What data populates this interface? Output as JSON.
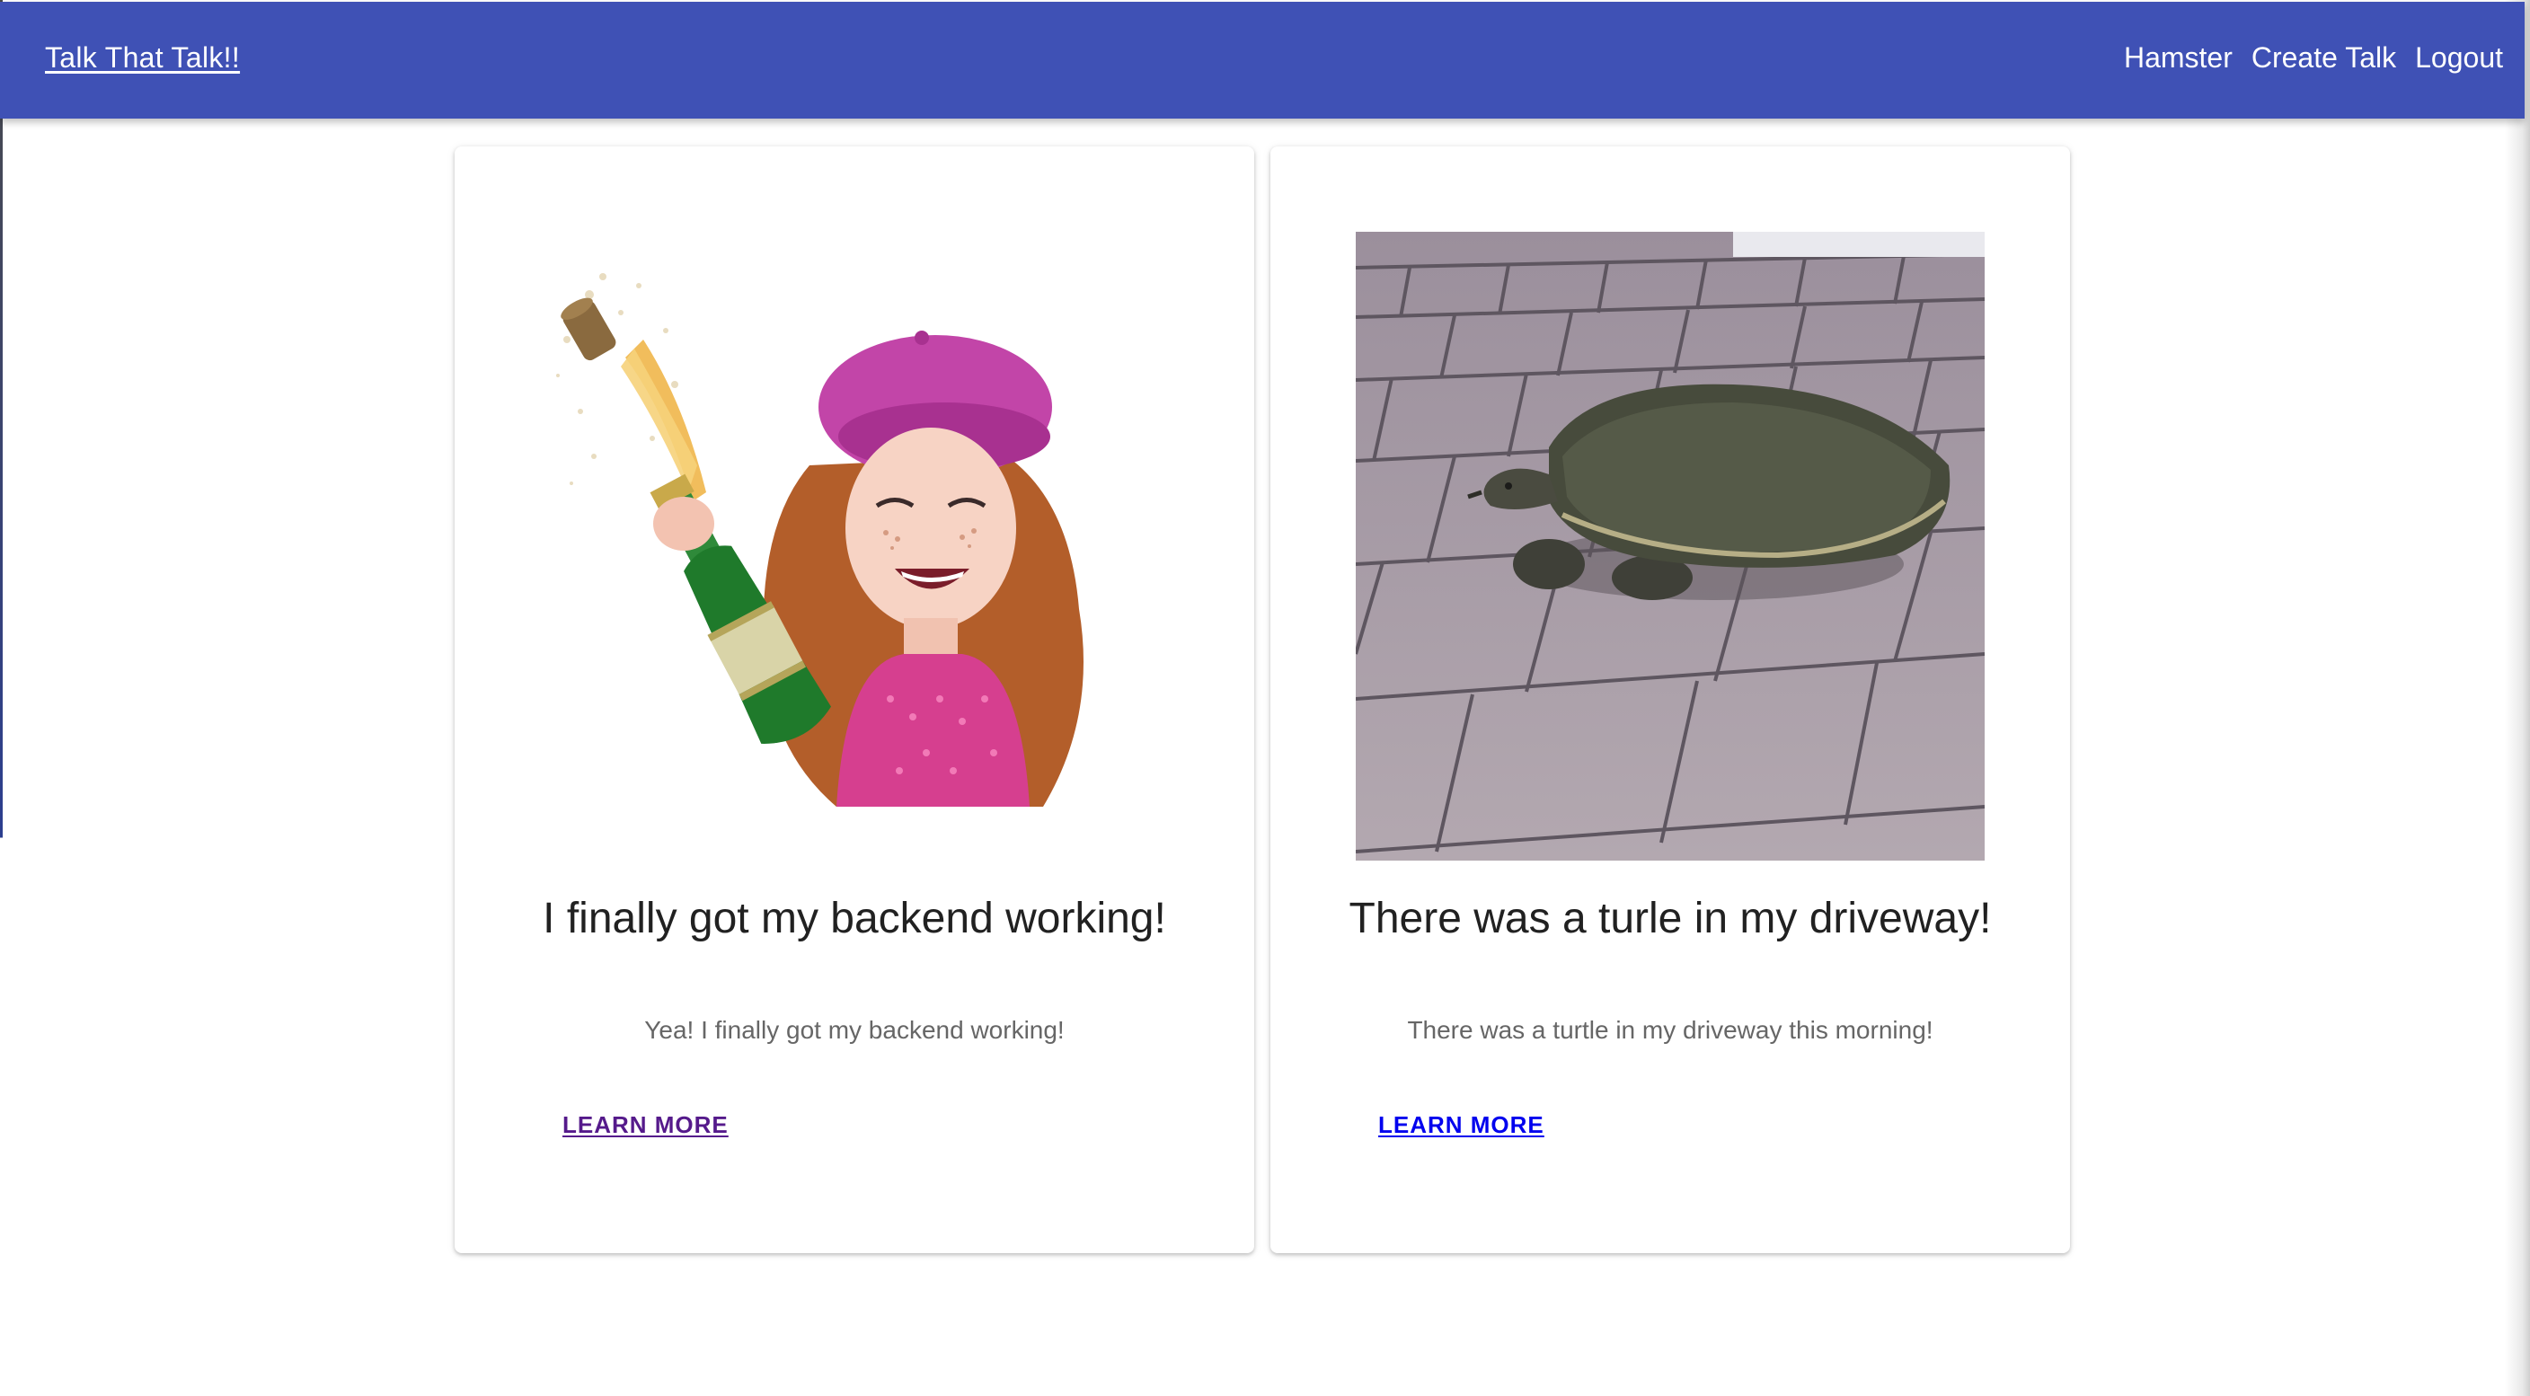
{
  "app_bar": {
    "brand": "Talk That Talk!!",
    "nav": {
      "user": "Hamster",
      "create": "Create Talk",
      "logout": "Logout"
    },
    "color": "#3f51b5"
  },
  "cards": [
    {
      "image": "celebration-avatar-champagne",
      "title": "I finally got my backend working!",
      "description": "Yea! I finally got my backend working!",
      "action": "LEARN MORE",
      "action_color": "#551a8b"
    },
    {
      "image": "turtle-on-driveway-photo",
      "title": "There was a turle in my driveway!",
      "description": "There was a turtle in my driveway this morning!",
      "action": "LEARN MORE",
      "action_color": "#0000ee"
    }
  ]
}
